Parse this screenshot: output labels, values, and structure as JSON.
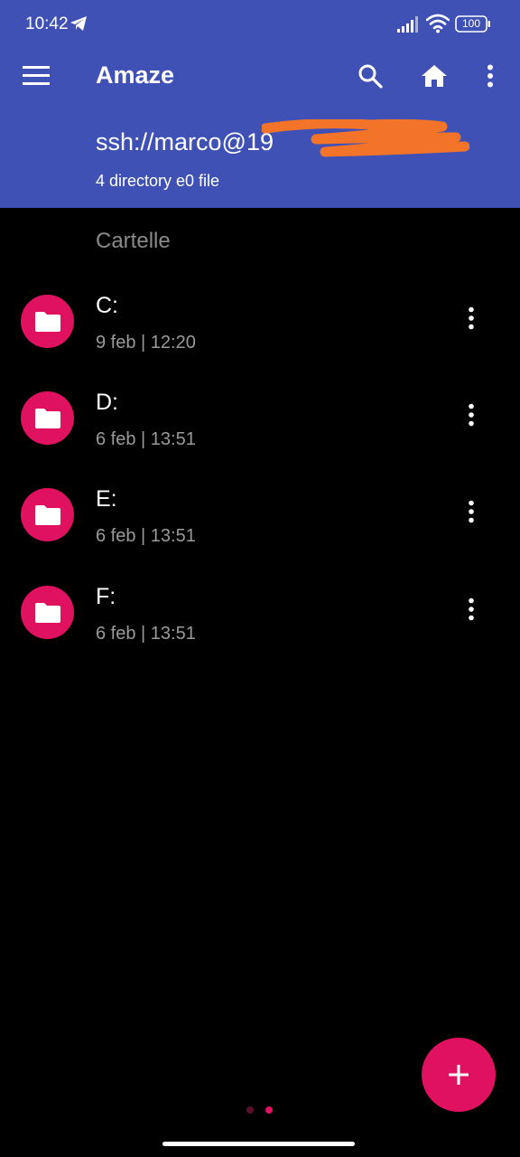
{
  "status_bar": {
    "time": "10:42",
    "battery": "100"
  },
  "toolbar": {
    "title": "Amaze"
  },
  "path": {
    "text": "ssh://marco@19                 22",
    "summary": "4 directory e0 file"
  },
  "list": {
    "section_header": "Cartelle",
    "items": [
      {
        "name": "C:",
        "date": "9 feb | 12:20"
      },
      {
        "name": "D:",
        "date": "6 feb | 13:51"
      },
      {
        "name": "E:",
        "date": "6 feb | 13:51"
      },
      {
        "name": "F:",
        "date": "6 feb | 13:51"
      }
    ]
  },
  "colors": {
    "header": "#3F51B5",
    "accent": "#E0115F",
    "background": "#000000"
  },
  "icons": [
    "telegram-icon",
    "signal-icon",
    "wifi-icon",
    "battery-icon",
    "menu-icon",
    "search-icon",
    "home-icon",
    "more-vert-icon",
    "folder-icon",
    "add-icon"
  ]
}
